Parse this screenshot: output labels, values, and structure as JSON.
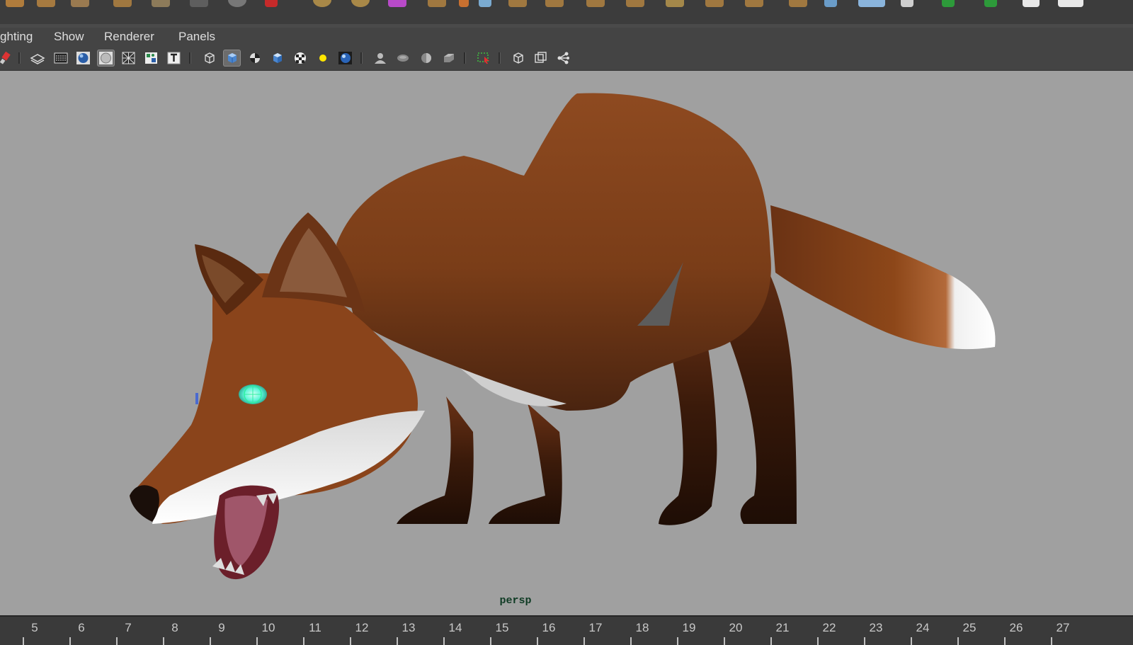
{
  "window": {
    "title": "Persp viewport with fox model"
  },
  "menubar": {
    "items": [
      {
        "id": "lighting",
        "label": "ghting"
      },
      {
        "id": "show",
        "label": "Show"
      },
      {
        "id": "renderer",
        "label": "Renderer"
      },
      {
        "id": "panels",
        "label": "Panels"
      }
    ]
  },
  "toolbar": {
    "icons": [
      "paint-brush-icon",
      "grid-toggle-icon",
      "film-gate-icon",
      "sphere-shading-icon",
      "smooth-shading-icon",
      "xray-icon",
      "uv-icon",
      "text-icon",
      "wireframe-cube-icon",
      "shaded-cube-icon",
      "checker-sphere-icon",
      "flat-cube-icon",
      "checker-texture-icon",
      "light-bulb-icon",
      "blue-sphere-icon",
      "shadow-bust-icon",
      "lamp-icon",
      "half-sphere-icon",
      "bevel-icon",
      "select-camera-icon",
      "isolate-icon",
      "frame-icon",
      "share-icon"
    ]
  },
  "viewport": {
    "camera_label": "persp",
    "background_color": "#a0a0a0",
    "subject": "fox-model"
  },
  "timeline": {
    "ticks": [
      5,
      6,
      7,
      8,
      9,
      10,
      11,
      12,
      13,
      14,
      15,
      16,
      17,
      18,
      19,
      20,
      21,
      22,
      23,
      24,
      25,
      26,
      27
    ]
  },
  "colors": {
    "ui_dark": "#444444",
    "viewport_bg": "#a0a0a0",
    "camera_label": "#0f3b24",
    "fox_fur": "#8e4a20",
    "fox_white": "#f2f2f2",
    "eye_highlight": "#5ff7d8"
  }
}
